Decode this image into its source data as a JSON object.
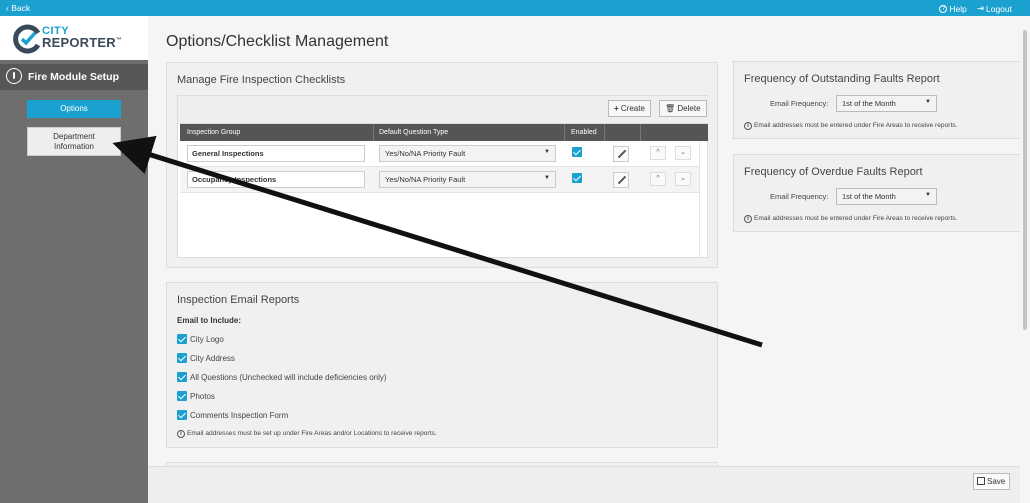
{
  "topbar": {
    "back_label": "Back",
    "help_label": "Help",
    "logout_label": "Logout",
    "bg_color": "#1ba1d0"
  },
  "sidebar": {
    "logo_city": "CITY",
    "logo_reporter": "REPORTER",
    "logo_tm": "™",
    "module_title": "Fire Module Setup",
    "items": [
      {
        "label": "Options",
        "active": true
      },
      {
        "label_line1": "Department",
        "label_line2": "Information",
        "active": false
      }
    ]
  },
  "page": {
    "title": "Options/Checklist Management"
  },
  "checklists": {
    "title": "Manage Fire Inspection Checklists",
    "create_label": "Create",
    "delete_label": "Delete",
    "columns": [
      "Inspection Group",
      "Default Question Type",
      "Enabled"
    ],
    "rows": [
      {
        "group": "General Inspections",
        "question_type": "Yes/No/NA Priority Fault",
        "enabled": true
      },
      {
        "group": "Occupancy Inspections",
        "question_type": "Yes/No/NA Priority Fault",
        "enabled": true
      }
    ]
  },
  "email_reports": {
    "title": "Inspection Email Reports",
    "include_label": "Email to Include:",
    "options": [
      {
        "label": "City Logo",
        "checked": true
      },
      {
        "label": "City Address",
        "checked": true
      },
      {
        "label": "All Questions (Unchecked will include deficiencies only)",
        "checked": true
      },
      {
        "label": "Photos",
        "checked": true
      },
      {
        "label": "Comments Inspection Form",
        "checked": true
      }
    ],
    "note": "Email addresses must be set up under Fire Areas and/or Locations to receive reports."
  },
  "outstanding": {
    "title": "Frequency of Outstanding Faults Report",
    "freq_label": "Email Frequency:",
    "freq_value": "1st of the Month",
    "note": "Email addresses must be entered under Fire Areas to receive reports."
  },
  "overdue": {
    "title": "Frequency of Overdue Faults Report",
    "freq_label": "Email Frequency:",
    "freq_value": "1st of the Month",
    "note": "Email addresses must be entered under Fire Areas to receive reports."
  },
  "footer": {
    "save_label": "Save"
  },
  "colors": {
    "accent": "#1ba1d0",
    "sidebar": "#6e6e6e",
    "header_row": "#555555"
  }
}
